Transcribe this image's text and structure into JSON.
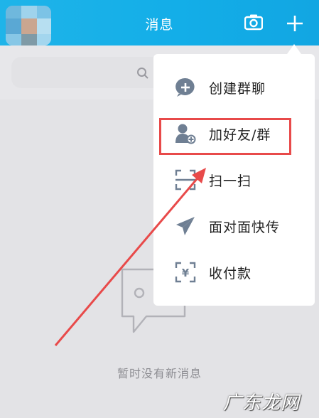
{
  "header": {
    "title": "消息"
  },
  "search": {
    "placeholder": ""
  },
  "menu": {
    "items": [
      {
        "label": "创建群聊",
        "icon": "create-group-icon"
      },
      {
        "label": "加好友/群",
        "icon": "add-friend-icon"
      },
      {
        "label": "扫一扫",
        "icon": "scan-icon"
      },
      {
        "label": "面对面快传",
        "icon": "send-icon"
      },
      {
        "label": "收付款",
        "icon": "payment-icon"
      }
    ]
  },
  "empty_state": {
    "text": "暂时没有新消息"
  },
  "watermark": {
    "text": "广东龙网"
  },
  "colors": {
    "header": "#13aee8",
    "highlight": "#e84a4a",
    "icon_gray": "#6f7f93"
  }
}
